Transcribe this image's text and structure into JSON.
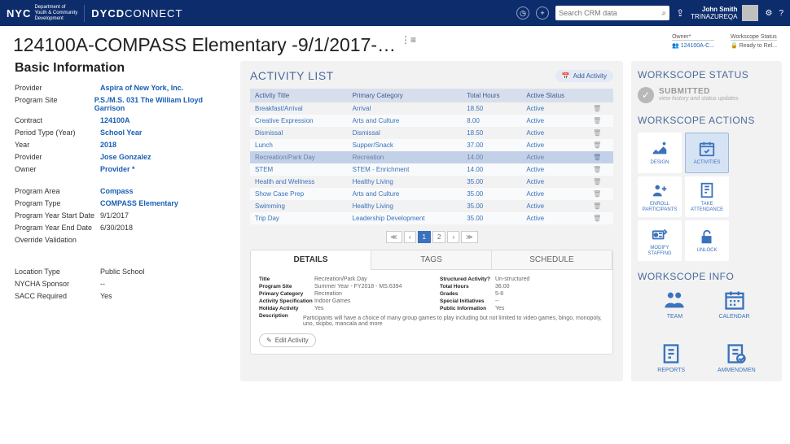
{
  "header": {
    "logo": "NYC",
    "dept1": "Department of",
    "dept2": "Youth & Community",
    "dept3": "Development",
    "brand": "DYCD",
    "brand2": "CONNECT",
    "search_placeholder": "Search CRM data",
    "user_name": "John Smith",
    "user_sub": "TRINAZUREQA"
  },
  "title": "124100A-COMPASS Elementary -9/1/2017-…",
  "owner_meta": {
    "k": "Owner*",
    "v": "124100A-C..."
  },
  "ws_meta": {
    "k": "Workscope Status",
    "v": "Ready to Rel..."
  },
  "basic": {
    "heading": "Basic Information",
    "rows": [
      {
        "k": "Provider",
        "v": "Aspira of New York, Inc.",
        "link": true
      },
      {
        "k": "Program Site",
        "v": "P.S./M.S. 031 The William Lloyd Garrison",
        "link": true
      },
      {
        "k": "Contract",
        "v": "124100A",
        "link": true
      },
      {
        "k": "Period Type (Year)",
        "v": "School Year",
        "link": true
      },
      {
        "k": "Year",
        "v": "2018",
        "link": true
      },
      {
        "k": "Provider",
        "v": "Jose Gonzalez",
        "link": true
      },
      {
        "k": "Owner",
        "v": "Provider *",
        "link": true
      }
    ],
    "rows2": [
      {
        "k": "Program Area",
        "v": "Compass",
        "link": true
      },
      {
        "k": "Program Type",
        "v": "COMPASS Elementary",
        "link": true
      },
      {
        "k": "Program Year Start Date",
        "v": "9/1/2017",
        "link": false
      },
      {
        "k": "Program Year End Date",
        "v": "6/30/2018",
        "link": false
      },
      {
        "k": "Override Validation",
        "v": "",
        "link": false
      }
    ],
    "rows3": [
      {
        "k": "Location Type",
        "v": "Public School",
        "link": false
      },
      {
        "k": "NYCHA Sponsor",
        "v": "--",
        "link": false
      },
      {
        "k": "SACC Required",
        "v": "Yes",
        "link": false
      }
    ]
  },
  "activity": {
    "heading": "ACTIVITY LIST",
    "add_label": "Add Activity",
    "cols": [
      "Activity Title",
      "Primary Category",
      "Total Hours",
      "Active Status"
    ],
    "rows": [
      {
        "t": "Breakfast/Arrival",
        "c": "Arrival",
        "h": "18.50",
        "s": "Active"
      },
      {
        "t": "Creative Expression",
        "c": "Arts and Culture",
        "h": "8.00",
        "s": "Active"
      },
      {
        "t": "Dismissal",
        "c": "Dismissal",
        "h": "18.50",
        "s": "Active"
      },
      {
        "t": "Lunch",
        "c": "Supper/Snack",
        "h": "37.00",
        "s": "Active"
      },
      {
        "t": "Recreation/Park Day",
        "c": "Recreation",
        "h": "14.00",
        "s": "Active",
        "sel": true
      },
      {
        "t": "STEM",
        "c": "STEM - Enrichment",
        "h": "14.00",
        "s": "Active"
      },
      {
        "t": "Health and Wellness",
        "c": "Healthy Living",
        "h": "35.00",
        "s": "Active"
      },
      {
        "t": "Show Case Prep",
        "c": "Arts and Culture",
        "h": "35.00",
        "s": "Active"
      },
      {
        "t": "Swimming",
        "c": "Healthy Living",
        "h": "35.00",
        "s": "Active"
      },
      {
        "t": "Trip Day",
        "c": "Leadership Development",
        "h": "35.00",
        "s": "Active"
      }
    ],
    "page_cur": "1",
    "page_next": "2"
  },
  "detail": {
    "tabs": [
      "DETAILS",
      "TAGS",
      "SCHEDULE"
    ],
    "left": [
      {
        "k": "Title",
        "v": "Recreation/Park Day"
      },
      {
        "k": "Program Site",
        "v": "Summer Year - FY2018 - MS.6394"
      },
      {
        "k": "Primary Category",
        "v": "Recreation"
      },
      {
        "k": "Activity Specification",
        "v": "Indoor Games"
      },
      {
        "k": "Holiday Activity",
        "v": "Yes"
      }
    ],
    "right": [
      {
        "k": "Structured Activity?",
        "v": "Un-structured"
      },
      {
        "k": "Total Hours",
        "v": "36.00"
      },
      {
        "k": "Grades",
        "v": "5-8"
      },
      {
        "k": "Special Initiatives",
        "v": "--"
      },
      {
        "k": "Public Information",
        "v": "Yes"
      }
    ],
    "desc_k": "Description",
    "desc_v": "Participants will have a choice of many group games to play including but not limited to video games, bingo, monopoly, uno, skipbo, mancala and more",
    "edit": "Edit Activity"
  },
  "ws": {
    "status_h": "WORKSCOPE STATUS",
    "status_t": "SUBMITTED",
    "status_sub": "view history and status updates",
    "actions_h": "WORKSCOPE ACTIONS",
    "actions": [
      "DESIGN",
      "ACTIVITIES",
      "ENROLL PARTICIPANTS",
      "TAKE ATTENDANCE",
      "MODIFY STAFFING",
      "UNLOCK"
    ],
    "info_h": "WORKSCOPE INFO",
    "info": [
      "TEAM",
      "CALENDAR",
      "REPORTS",
      "AMMENDMEN"
    ]
  }
}
